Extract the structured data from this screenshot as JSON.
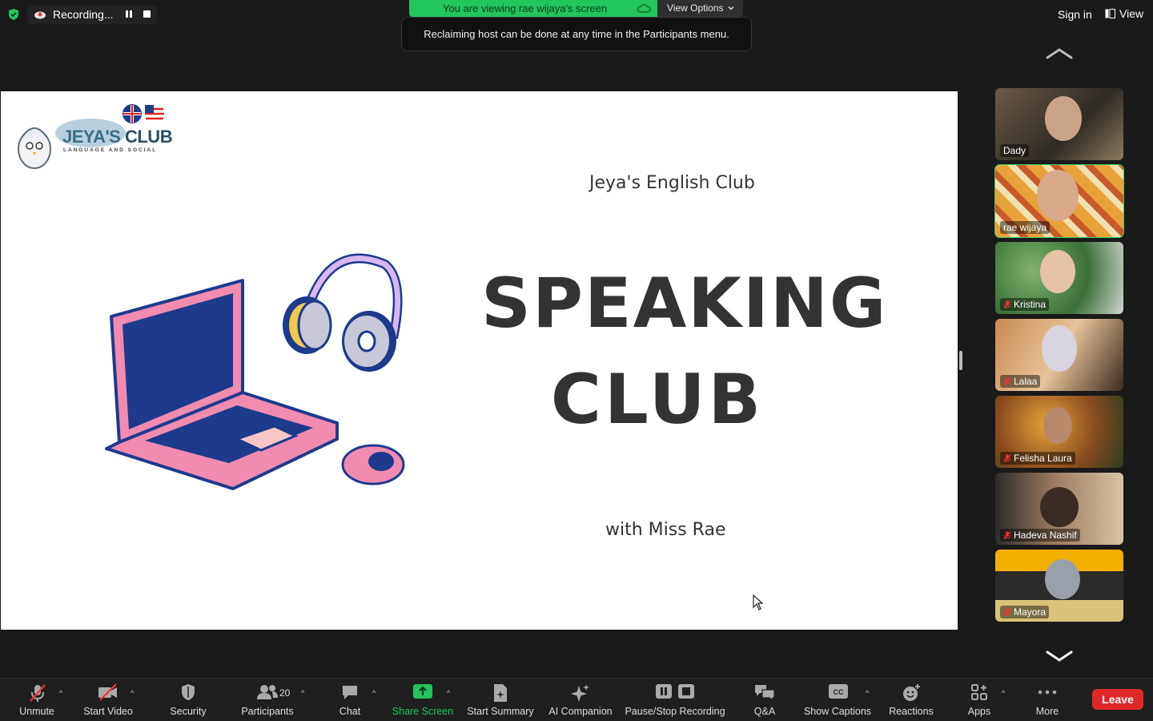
{
  "topbar": {
    "recording_label": "Recording...",
    "viewing_banner": "You are viewing rae wijaya's screen",
    "view_options": "View Options",
    "toast": "Reclaiming host can be done at any time in the Participants menu.",
    "sign_in": "Sign in",
    "view": "View"
  },
  "slide": {
    "logo_main": "JEYA'S",
    "logo_club": "CLUB",
    "logo_sub": "LANGUAGE AND SOCIAL",
    "club_heading": "Jeya's English Club",
    "title_line1": "SPEAKING",
    "title_line2": "CLUB",
    "subtitle": "with Miss Rae"
  },
  "gallery": [
    {
      "name": "Dady",
      "muted": false,
      "active": false
    },
    {
      "name": "rae wijaya",
      "muted": false,
      "active": true
    },
    {
      "name": "Kristina",
      "muted": true,
      "active": false
    },
    {
      "name": "Lalaa",
      "muted": true,
      "active": false
    },
    {
      "name": "Felisha Laura",
      "muted": true,
      "active": false
    },
    {
      "name": "Hadeva Nashif",
      "muted": true,
      "active": false
    },
    {
      "name": "Mayora",
      "muted": true,
      "active": false
    }
  ],
  "toolbar": {
    "unmute": "Unmute",
    "start_video": "Start Video",
    "security": "Security",
    "participants": "Participants",
    "participants_count": "20",
    "chat": "Chat",
    "share_screen": "Share Screen",
    "start_summary": "Start Summary",
    "ai_companion": "AI Companion",
    "pause_stop_recording": "Pause/Stop Recording",
    "qa": "Q&A",
    "show_captions": "Show Captions",
    "reactions": "Reactions",
    "apps": "Apps",
    "more": "More",
    "leave": "Leave"
  },
  "colors": {
    "accent_green": "#22c55e",
    "leave_red": "#e02828",
    "active_border": "#3fd15f"
  }
}
